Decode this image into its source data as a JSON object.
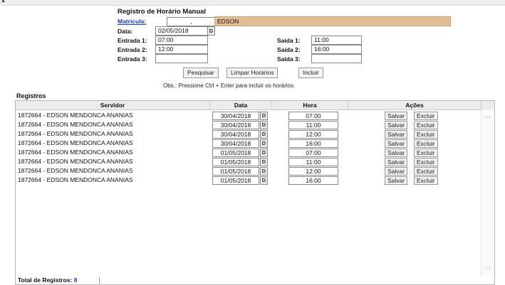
{
  "topbar": {
    "arrow": "▲"
  },
  "form": {
    "title": "Registro de Horário Manual",
    "matricula_label": "Matrícula:",
    "matricula_value": ",",
    "nome_value": "EDSON",
    "data_label": "Data:",
    "data_value": "02/05/2018",
    "date_button": "D",
    "entrada1_label": "Entrada 1:",
    "entrada1_value": "07:00",
    "entrada2_label": "Entrada 2:",
    "entrada2_value": "12:00",
    "entrada3_label": "Entrada 3:",
    "entrada3_value": "",
    "saida1_label": "Saída 1:",
    "saida1_value": "11:00",
    "saida2_label": "Saída 2:",
    "saida2_value": "16:00",
    "saida3_label": "Saída 3:",
    "saida3_value": "",
    "buttons": {
      "pesquisar": "Pesquisar",
      "limpar": "Limpar Horários",
      "incluir": "Incluir"
    },
    "obs": "Obs.: Pressione Ctrl + Enter para incluir os horários."
  },
  "registros": {
    "title": "Registros",
    "columns": [
      "Servidor",
      "Data",
      "Hora",
      "Ações"
    ],
    "action_labels": {
      "salvar": "Salvar",
      "excluir": "Excluir"
    },
    "date_button": "D",
    "rows": [
      {
        "servidor": "1872664 - EDSON MENDONCA ANANIAS",
        "data": "30/04/2018",
        "hora": "07:00"
      },
      {
        "servidor": "1872664 - EDSON MENDONCA ANANIAS",
        "data": "30/04/2018",
        "hora": "11:00"
      },
      {
        "servidor": "1872664 - EDSON MENDONCA ANANIAS",
        "data": "30/04/2018",
        "hora": "12:00"
      },
      {
        "servidor": "1872664 - EDSON MENDONCA ANANIAS",
        "data": "30/04/2018",
        "hora": "16:00"
      },
      {
        "servidor": "1872664 - EDSON MENDONCA ANANIAS",
        "data": "01/05/2018",
        "hora": "07:00"
      },
      {
        "servidor": "1872664 - EDSON MENDONCA ANANIAS",
        "data": "01/05/2018",
        "hora": "11:00"
      },
      {
        "servidor": "1872664 - EDSON MENDONCA ANANIAS",
        "data": "01/05/2018",
        "hora": "12:00"
      },
      {
        "servidor": "1872664 - EDSON MENDONCA ANANIAS",
        "data": "01/05/2018",
        "hora": "16:00"
      }
    ],
    "total_label": "Total de Registros:",
    "total_count": "8",
    "scroll_up": "︿",
    "scroll_down": "﹀"
  }
}
